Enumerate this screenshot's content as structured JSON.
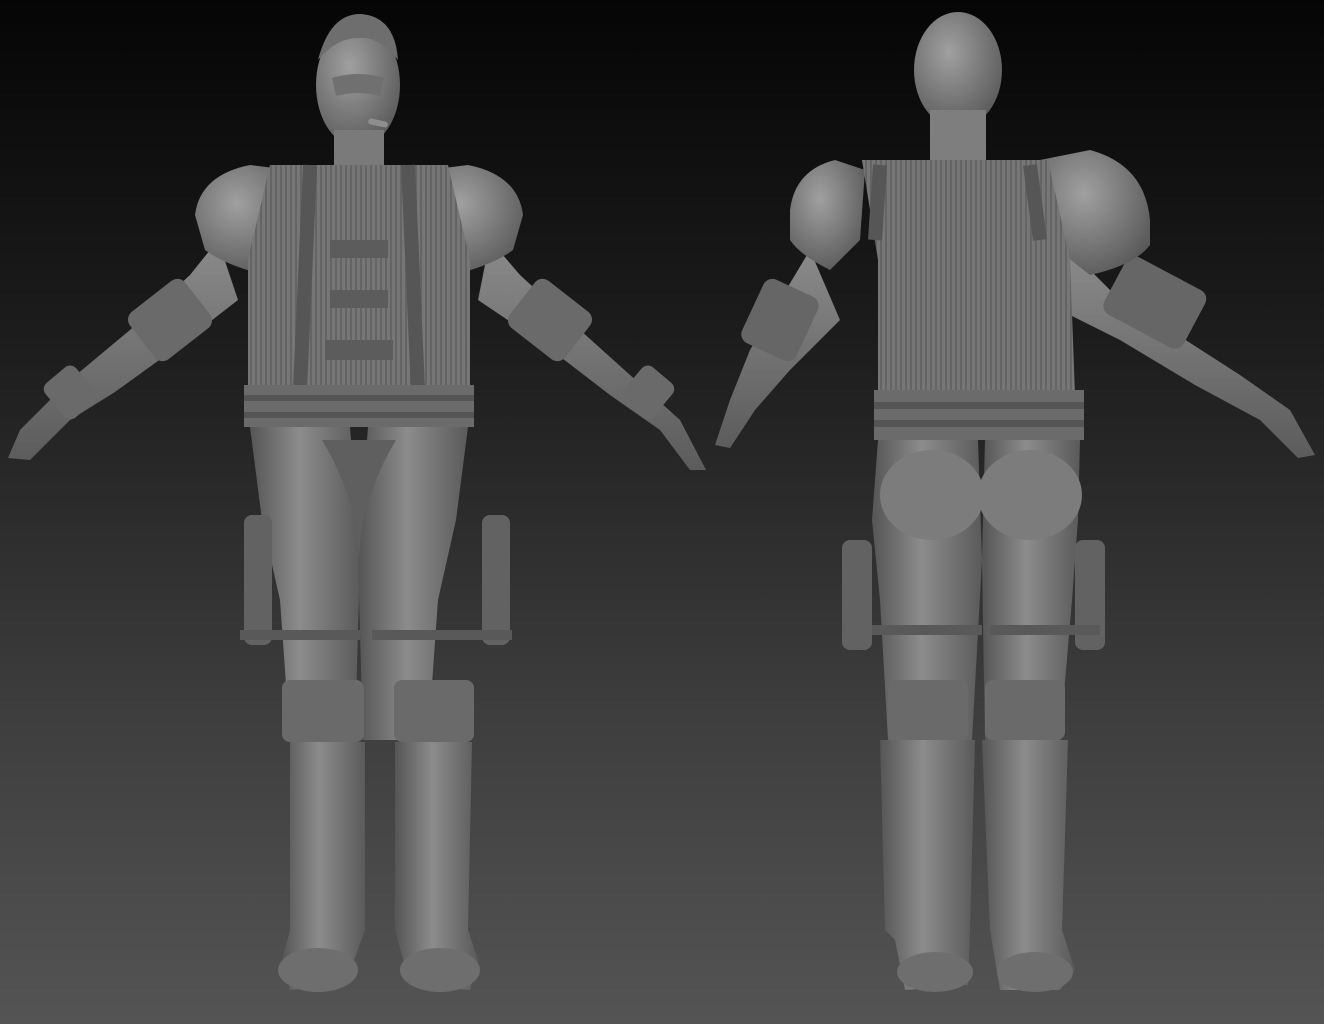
{
  "scene": {
    "background_top": "#050505",
    "background_bottom": "#545454",
    "material_light": "#9a9a9a",
    "material_mid": "#6f6f6f",
    "material_dark": "#4a4a4a",
    "views": [
      {
        "name": "front-view"
      },
      {
        "name": "back-view"
      }
    ]
  }
}
